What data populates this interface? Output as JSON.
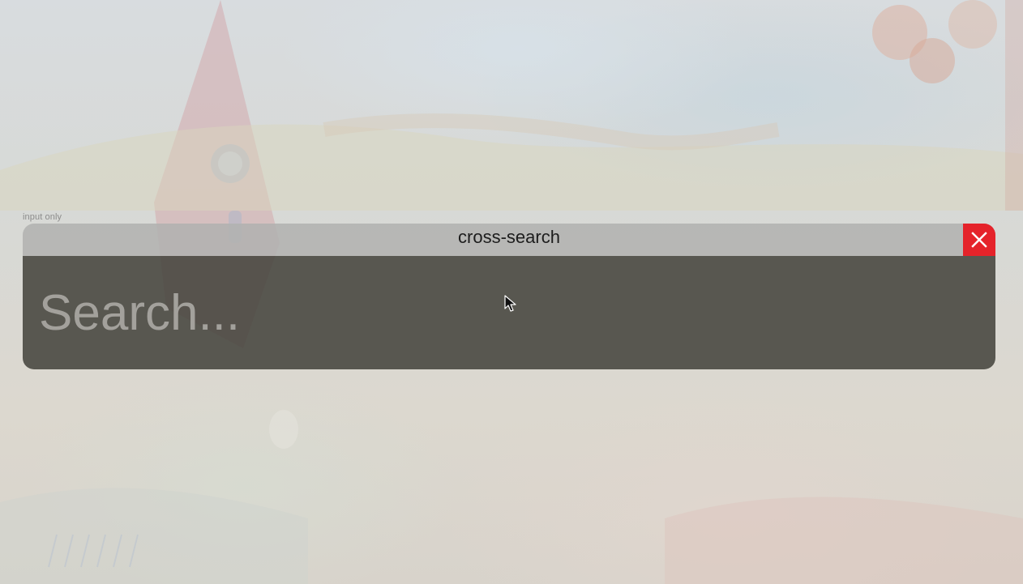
{
  "context_label": "input only",
  "widget": {
    "title": "cross-search",
    "close_icon": "close-icon",
    "search": {
      "value": "",
      "placeholder": "Search..."
    }
  },
  "colors": {
    "close_button": "#e5232a",
    "titlebar": "#b2b2b0",
    "search_area": "#46443e",
    "placeholder": "#a3a19c"
  }
}
